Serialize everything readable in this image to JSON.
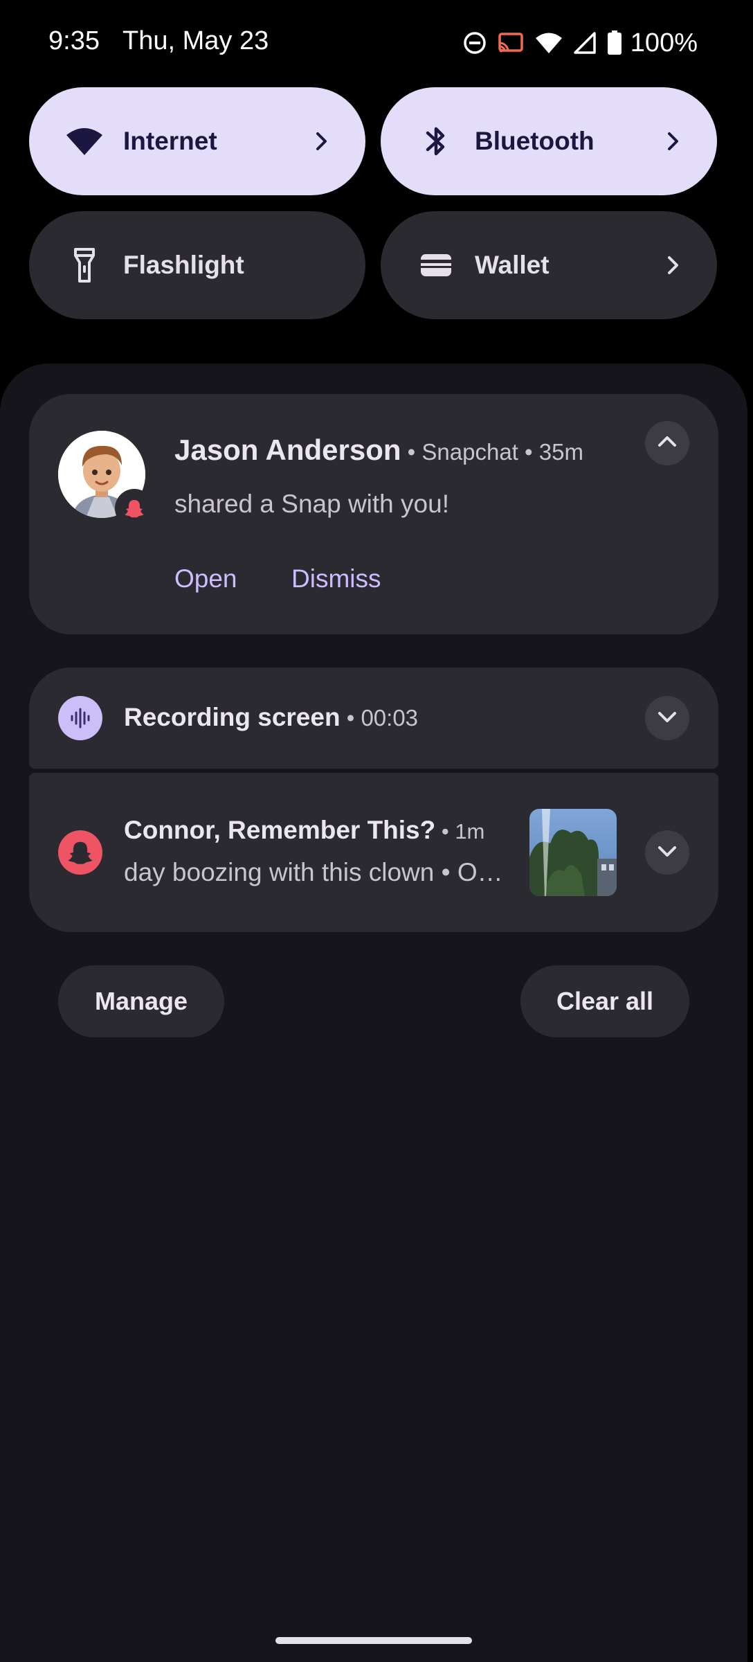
{
  "status_bar": {
    "time": "9:35",
    "date": "Thu, May 23",
    "battery": "100%",
    "icons": [
      "do-not-disturb-icon",
      "cast-icon",
      "wifi-icon",
      "signal-icon",
      "battery-icon"
    ]
  },
  "quick_settings": {
    "tiles": [
      {
        "label": "Internet",
        "icon": "wifi-icon",
        "state": "on"
      },
      {
        "label": "Bluetooth",
        "icon": "bluetooth-icon",
        "state": "on"
      },
      {
        "label": "Flashlight",
        "icon": "flashlight-icon",
        "state": "off"
      },
      {
        "label": "Wallet",
        "icon": "wallet-icon",
        "state": "off"
      }
    ]
  },
  "notifications": {
    "snap_message": {
      "sender": "Jason Anderson",
      "meta": " • Snapchat • 35m",
      "text": "shared a Snap with you!",
      "actions": [
        "Open",
        "Dismiss"
      ]
    },
    "recording": {
      "title": "Recording screen",
      "meta": " • 00:03"
    },
    "memory": {
      "title": "Connor, Remember This?",
      "meta": " • 1m",
      "text": "day boozing with this clown • O…"
    }
  },
  "footer": {
    "manage_label": "Manage",
    "clear_all_label": "Clear all"
  },
  "colors": {
    "tile_on": "#e3ddfa",
    "tile_off": "#2b2a31",
    "accent_text": "#cdbdff",
    "snapchat_red": "#ef5464"
  }
}
